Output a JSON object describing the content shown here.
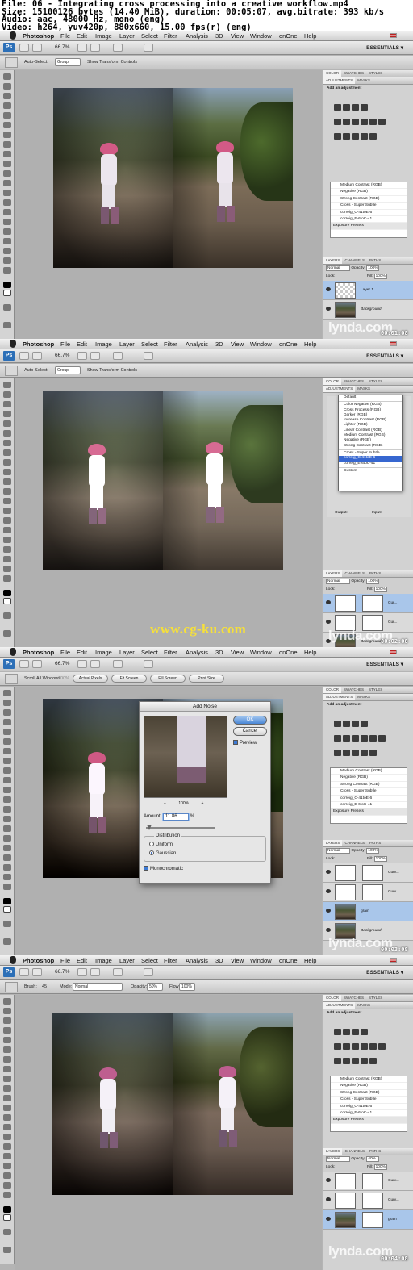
{
  "file_info": {
    "line1": "File: 06 - Integrating cross processing into a creative workflow.mp4",
    "line2": "Size: 15100126 bytes (14.40 MiB), duration: 00:05:07, avg.bitrate: 393 kb/s",
    "line3": "Audio: aac, 48000 Hz, mono (eng)",
    "line4": "Video: h264, yuv420p, 880x660, 15.00 fps(r) (eng)"
  },
  "menu": [
    "Photoshop",
    "File",
    "Edit",
    "Image",
    "Layer",
    "Select",
    "Filter",
    "Analysis",
    "3D",
    "View",
    "Window",
    "onOne",
    "Help"
  ],
  "app": {
    "zoom": "66.7%",
    "workspace": "ESSENTIALS ▾"
  },
  "options_move": {
    "auto_select": "Auto-Select:",
    "group": "Group",
    "transform": "Show Transform Controls"
  },
  "options_hand": {
    "scroll_all": "Scroll All Windows",
    "zoom_field": "100%",
    "actual": "Actual Pixels",
    "fit": "Fit Screen",
    "fill": "Fill Screen",
    "print": "Print Size"
  },
  "options_brush": {
    "brush": "Brush:",
    "brush_size": "45",
    "mode": "Mode:",
    "mode_val": "Normal",
    "opacity": "Opacity:",
    "opacity_val": "50%",
    "flow": "Flow:",
    "flow_val": "100%"
  },
  "panels": {
    "top_tabs": [
      "COLOR",
      "SWATCHES",
      "STYLES"
    ],
    "adj_tabs": [
      "ADJUSTMENTS",
      "MASKS"
    ],
    "add_adjustment": "Add an adjustment",
    "presets": [
      "Medium Contrast (RGB)",
      "Negative (RGB)",
      "Strong Contrast (RGB)",
      "Cross - Super Subtle",
      "correig_C-41toE-6",
      "correig_E-6toC-41"
    ],
    "presets_group": "Exposure Presets",
    "layer_tabs": [
      "LAYERS",
      "CHANNELS",
      "PATHS"
    ],
    "blend": "Normal",
    "opacity_label": "Opacity:",
    "opacity": "100%",
    "lock": "Lock:",
    "fill_label": "Fill:",
    "fill": "100%",
    "frame4_opacity": "40%"
  },
  "layers_f1": [
    {
      "name": "Layer 1",
      "selected": true
    },
    {
      "name": "Background",
      "selected": false
    }
  ],
  "layers_f2": [
    {
      "name": "Cur...",
      "selected": true
    },
    {
      "name": "Cur...",
      "selected": false
    },
    {
      "name": "Background",
      "selected": false
    }
  ],
  "layers_f3": [
    {
      "name": "Curv...",
      "selected": false
    },
    {
      "name": "Curv...",
      "selected": false
    },
    {
      "name": "grain",
      "selected": true
    },
    {
      "name": "Background",
      "selected": false
    }
  ],
  "layers_f4": [
    {
      "name": "Curv...",
      "selected": false
    },
    {
      "name": "Curv...",
      "selected": false
    },
    {
      "name": "grain",
      "selected": true
    }
  ],
  "curves_menu": {
    "default": "Default",
    "items": [
      "Color Negative (RGB)",
      "Cross Process (RGB)",
      "Darker (RGB)",
      "Increase Contrast (RGB)",
      "Lighter (RGB)",
      "Linear Contrast (RGB)",
      "Medium Contrast (RGB)",
      "Negative (RGB)",
      "Strong Contrast (RGB)"
    ],
    "custom_items": [
      "Cross - Super Subtle",
      "correig_C-41toE-6",
      "correig_E-6toC-41"
    ],
    "highlighted": "correig_C-41toE-6",
    "custom": "Custom",
    "output": "Output:",
    "input": "Input:"
  },
  "add_noise": {
    "title": "Add Noise",
    "ok": "OK",
    "cancel": "Cancel",
    "preview": "Preview",
    "zoom": "100%",
    "amount_label": "Amount:",
    "amount": "11.86",
    "unit": "%",
    "distribution": "Distribution",
    "uniform": "Uniform",
    "gaussian": "Gaussian",
    "monochromatic": "Monochromatic"
  },
  "watermark": "lynda.com",
  "timecodes": [
    "00:01:08",
    "00:02:08",
    "00:03:08",
    "00:04:08"
  ],
  "site_watermark": "www.cg-ku.com"
}
